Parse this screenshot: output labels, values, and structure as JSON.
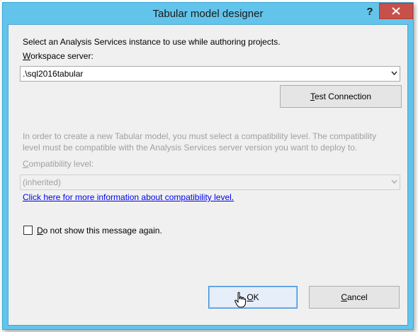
{
  "window": {
    "title": "Tabular model designer",
    "help": "?"
  },
  "instruction": "Select an Analysis Services instance to use while authoring projects.",
  "workspace": {
    "label_underlined": "W",
    "label_rest": "orkspace server:",
    "value": ".\\sql2016tabular"
  },
  "test_button": {
    "underlined": "T",
    "rest": "est Connection"
  },
  "compat": {
    "info_line1": "In order to create a new Tabular model, you must select a compatibility level. The compatibility",
    "info_line2": "level must be compatible with the Analysis Services server version you want to deploy to.",
    "label_underlined": "C",
    "label_rest": "ompatibility level:",
    "value": "(inherited)",
    "link": "Click here for more information about compatibility level."
  },
  "checkbox": {
    "underlined": "D",
    "rest": "o not show this message again.",
    "checked": false
  },
  "ok_button": {
    "underlined": "O",
    "rest": "K"
  },
  "cancel_button": {
    "underlined": "C",
    "rest": "ancel"
  },
  "colors": {
    "titlebar": "#62c4ea",
    "close": "#c7504b",
    "client": "#f0f0f0",
    "link": "#0000ee"
  }
}
